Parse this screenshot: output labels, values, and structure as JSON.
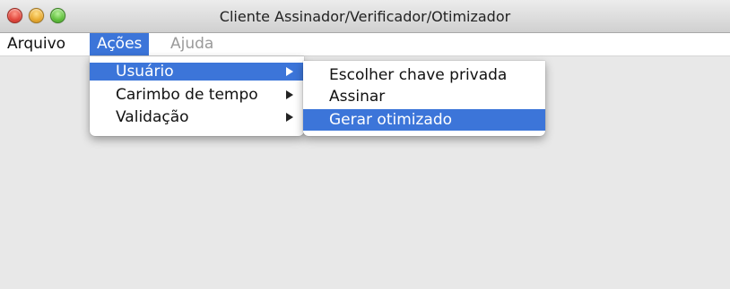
{
  "window": {
    "title": "Cliente Assinador/Verificador/Otimizador"
  },
  "menubar": {
    "items": [
      {
        "label": "Arquivo",
        "enabled": true,
        "active": false
      },
      {
        "label": "Ações",
        "enabled": true,
        "active": true
      },
      {
        "label": "Ajuda",
        "enabled": false,
        "active": false
      }
    ]
  },
  "acoes_menu": {
    "items": [
      {
        "label": "Usuário",
        "has_submenu": true,
        "highlighted": true
      },
      {
        "label": "Carimbo de tempo",
        "has_submenu": true,
        "highlighted": false
      },
      {
        "label": "Validação",
        "has_submenu": true,
        "highlighted": false
      }
    ]
  },
  "usuario_submenu": {
    "items": [
      {
        "label": "Escolher chave privada",
        "highlighted": false
      },
      {
        "label": "Assinar",
        "highlighted": false
      },
      {
        "label": "Gerar otimizado",
        "highlighted": true
      }
    ]
  },
  "colors": {
    "highlight": "#3c75d9",
    "disabled_text": "#9a9a9a",
    "window_background": "#e8e8e8"
  },
  "icons": {
    "close": "close-icon",
    "minimize": "minimize-icon",
    "maximize": "maximize-icon",
    "submenu_arrow": "chevron-right-icon"
  }
}
